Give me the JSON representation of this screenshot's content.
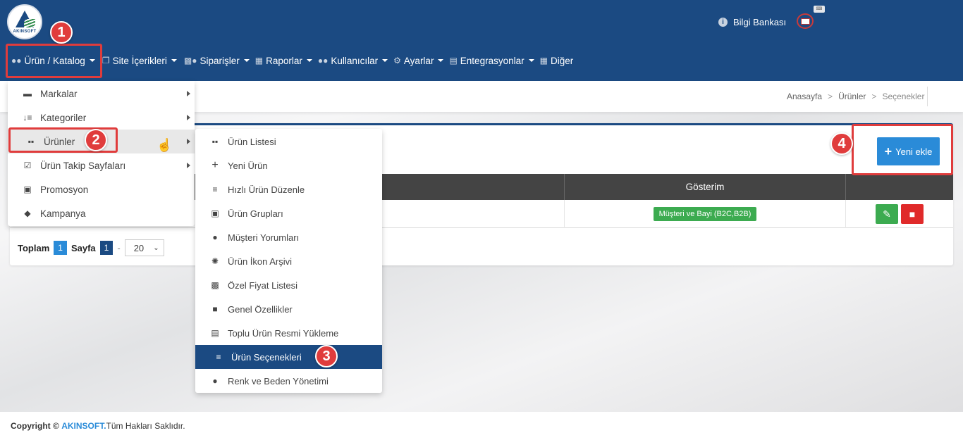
{
  "header": {
    "logo_text": "AKINSOFT",
    "bilgi_label": "Bilgi Bankası",
    "info_icon": "i",
    "kbd_icon_text": "⌨"
  },
  "nav": {
    "items": [
      {
        "label": "Ürün / Katalog",
        "icon": "users-icon",
        "has_caret": true
      },
      {
        "label": "Site İçerikleri",
        "icon": "copy-icon",
        "has_caret": true
      },
      {
        "label": "Siparişler",
        "icon": "truck-icon",
        "has_caret": true
      },
      {
        "label": "Raporlar",
        "icon": "report-icon",
        "has_caret": true
      },
      {
        "label": "Kullanıcılar",
        "icon": "users-icon",
        "has_caret": true
      },
      {
        "label": "Ayarlar",
        "icon": "gears-icon",
        "has_caret": true
      },
      {
        "label": "Entegrasyonlar",
        "icon": "sitemap-icon",
        "has_caret": true
      },
      {
        "label": "Diğer",
        "icon": "grid-icon",
        "has_caret": false
      }
    ]
  },
  "breadcrumb": {
    "items": [
      "Anasayfa",
      "Ürünler",
      "Seçenekler"
    ],
    "sep": ">"
  },
  "menu_catalog": {
    "items": [
      {
        "label": "Markalar",
        "icon": "credit-card-icon",
        "has_submenu": true
      },
      {
        "label": "Kategoriler",
        "icon": "sort-icon",
        "has_submenu": true
      },
      {
        "label": "Ürünler",
        "icon": "cubes-icon",
        "has_submenu": true
      },
      {
        "label": "Ürün Takip Sayfaları",
        "icon": "calendar-check-icon",
        "has_submenu": true
      },
      {
        "label": "Promosyon",
        "icon": "gift-icon",
        "has_submenu": false
      },
      {
        "label": "Kampanya",
        "icon": "tags-icon",
        "has_submenu": false
      }
    ]
  },
  "menu_products": {
    "items": [
      {
        "label": "Ürün Listesi",
        "icon": "cubes-icon"
      },
      {
        "label": "Yeni Ürün",
        "icon": "plus-icon"
      },
      {
        "label": "Hızlı Ürün Düzenle",
        "icon": "list-icon"
      },
      {
        "label": "Ürün Grupları",
        "icon": "object-group-icon"
      },
      {
        "label": "Müşteri Yorumları",
        "icon": "comments-icon"
      },
      {
        "label": "Ürün İkon Arşivi",
        "icon": "atom-icon"
      },
      {
        "label": "Özel Fiyat Listesi",
        "icon": "money-icon"
      },
      {
        "label": "Genel Özellikler",
        "icon": "puzzle-icon"
      },
      {
        "label": "Toplu Ürün Resmi Yükleme",
        "icon": "image-icon"
      },
      {
        "label": "Ürün Seçenekleri",
        "icon": "list-ol-icon"
      },
      {
        "label": "Renk ve Beden Yönetimi",
        "icon": "cubes-stack-icon"
      }
    ],
    "selected_index": 9
  },
  "annotations": [
    "1",
    "2",
    "3",
    "4"
  ],
  "toolbar": {
    "new_label": "Yeni ekle",
    "new_icon": "+"
  },
  "table": {
    "columns": [
      "Gösterim"
    ],
    "rows": [
      {
        "gosterim": "Müşteri ve Bayi (B2C,B2B)"
      }
    ]
  },
  "pager": {
    "total_label": "Toplam",
    "total_value": "1",
    "page_label": "Sayfa",
    "page_value": "1",
    "dash": "-",
    "page_size": "20"
  },
  "footer": {
    "copyright": "Copyright ©",
    "brand": "AKINSOFT.",
    "rights": "Tüm Hakları Saklıdır."
  },
  "colors": {
    "header_bg": "#1b4a82",
    "accent_blue": "#2a8bd8",
    "success_green": "#3cab50",
    "danger_red": "#e02a2a",
    "annotation_red": "#e03c3c"
  }
}
